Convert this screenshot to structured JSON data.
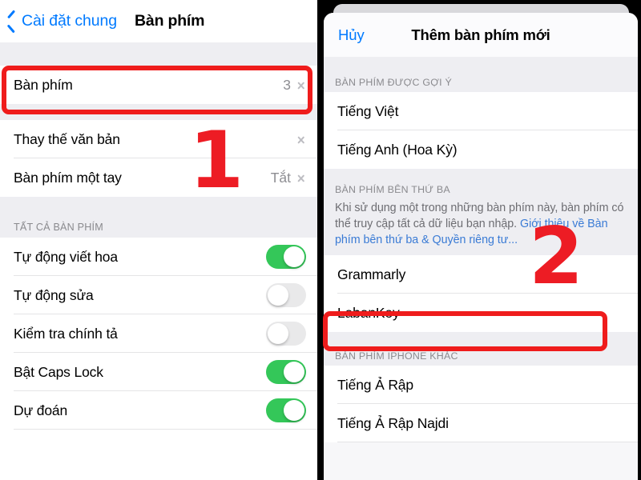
{
  "accent": {
    "blue": "#007aff",
    "green": "#34c759",
    "red": "#ed1c24",
    "gray_value": "#8e8e93"
  },
  "left_panel": {
    "nav": {
      "back_icon": "chevron-left-icon",
      "back_label": "Cài đặt chung",
      "title": "Bàn phím"
    },
    "group1": {
      "rows": [
        {
          "label": "Bàn phím",
          "value": "3",
          "accessory": "disclosure-chevron-icon"
        }
      ]
    },
    "group2": {
      "rows": [
        {
          "label": "Thay thế văn bản",
          "value": "",
          "accessory": "disclosure-chevron-icon"
        },
        {
          "label": "Bàn phím một tay",
          "value": "Tắt",
          "accessory": "disclosure-chevron-icon"
        }
      ]
    },
    "group3": {
      "header": "TẤT CẢ BÀN PHÍM",
      "rows": [
        {
          "label": "Tự động viết hoa",
          "state": "on"
        },
        {
          "label": "Tự động sửa",
          "state": "off"
        },
        {
          "label": "Kiểm tra chính tả",
          "state": "off"
        },
        {
          "label": "Bật Caps Lock",
          "state": "on"
        },
        {
          "label": "Dự đoán",
          "state": "on"
        }
      ]
    }
  },
  "right_panel": {
    "sheet_nav": {
      "cancel_label": "Hủy",
      "title": "Thêm bàn phím mới"
    },
    "suggested": {
      "header": "BÀN PHÍM ĐƯỢC GỢI Ý",
      "rows": [
        {
          "label": "Tiếng Việt"
        },
        {
          "label": "Tiếng Anh (Hoa Kỳ)"
        }
      ]
    },
    "third_party": {
      "header": "BÀN PHÍM BÊN THỨ BA",
      "description": "Khi sử dụng một trong những bàn phím này, bàn phím có thể truy cập tất cả dữ liệu bạn nhập. ",
      "link_text": "Giới thiệu về Bàn phím bên thứ ba & Quyền riêng tư...",
      "rows": [
        {
          "label": "Grammarly"
        },
        {
          "label": "LabanKey"
        }
      ]
    },
    "other": {
      "header": "BÀN PHÍM IPHONE KHÁC",
      "rows": [
        {
          "label": "Tiếng Ả Rập"
        },
        {
          "label": "Tiếng Ả Rập Najdi"
        }
      ]
    }
  },
  "annotations": {
    "step_one": "1",
    "step_two": "2"
  }
}
